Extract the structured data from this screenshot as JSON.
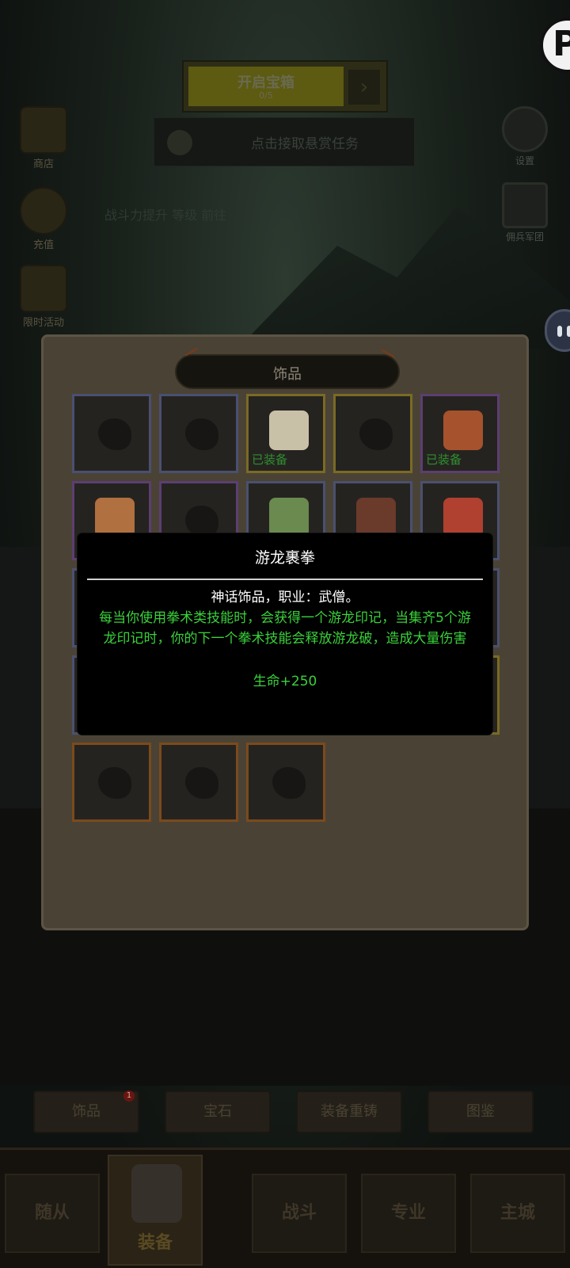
{
  "background": {
    "top_banner_title": "开启宝箱",
    "top_banner_sub": "0/5",
    "task_button": "点击接取悬赏任务",
    "dim_text": "战斗力提升 等级 前往",
    "left_buttons": [
      {
        "label": "商店",
        "icon": "chest-icon"
      },
      {
        "label": "充值",
        "icon": "coin-icon"
      },
      {
        "label": "限时活动",
        "icon": "armor-icon"
      }
    ],
    "right_buttons": [
      {
        "label": "设置",
        "icon": "gear-icon"
      },
      {
        "label": "佣兵军团",
        "icon": "castle-icon"
      }
    ],
    "action_buttons": [
      {
        "label": "饰品",
        "badge": "1"
      },
      {
        "label": "宝石"
      },
      {
        "label": "装备重铸"
      },
      {
        "label": "图鉴"
      }
    ],
    "nav": [
      {
        "label": "随从"
      },
      {
        "label": "装备"
      },
      {
        "label": "战斗"
      },
      {
        "label": "专业"
      },
      {
        "label": "主城"
      }
    ]
  },
  "panel": {
    "title": "饰品",
    "equipped_label": "已装备",
    "slots": [
      {
        "rarity": "blue",
        "equipped": false,
        "item": false
      },
      {
        "rarity": "blue",
        "equipped": false,
        "item": false
      },
      {
        "rarity": "yellow",
        "equipped": true,
        "item": true,
        "item_color": "#c9c0a8"
      },
      {
        "rarity": "yellow",
        "equipped": false,
        "item": false
      },
      {
        "rarity": "purple",
        "equipped": true,
        "item": true,
        "item_color": "#a6522c"
      },
      {
        "rarity": "purple",
        "equipped": false,
        "item": true,
        "item_color": "#b07040"
      },
      {
        "rarity": "purple",
        "equipped": false,
        "item": false
      },
      {
        "rarity": "blue",
        "equipped": false,
        "item": true,
        "item_color": "#6a8a50"
      },
      {
        "rarity": "blue",
        "equipped": false,
        "item": true,
        "item_color": "#6a3a2a"
      },
      {
        "rarity": "blue",
        "equipped": false,
        "item": true,
        "item_color": "#b04030"
      },
      {
        "rarity": "blue",
        "equipped": false,
        "item": false
      },
      {
        "rarity": "blue",
        "equipped": false,
        "item": false
      },
      {
        "rarity": "blue",
        "equipped": false,
        "item": false
      },
      {
        "rarity": "blue",
        "equipped": false,
        "item": false
      },
      {
        "rarity": "blue",
        "equipped": false,
        "item": false
      },
      {
        "rarity": "blue",
        "equipped": false,
        "item": false
      },
      {
        "rarity": "yellow",
        "equipped": false,
        "item": false
      },
      {
        "rarity": "yellow",
        "equipped": false,
        "item": false
      },
      {
        "rarity": "yellow",
        "equipped": false,
        "item": false
      },
      {
        "rarity": "yellow",
        "equipped": false,
        "item": false
      },
      {
        "rarity": "orange",
        "equipped": false,
        "item": false
      },
      {
        "rarity": "orange",
        "equipped": false,
        "item": false
      },
      {
        "rarity": "orange",
        "equipped": false,
        "item": false
      }
    ]
  },
  "tooltip": {
    "name": "游龙裹拳",
    "type_line": "神话饰品，职业：武僧。",
    "description": "每当你使用拳术类技能时，会获得一个游龙印记，当集齐5个游龙印记时，你的下一个拳术技能会释放游龙破，造成大量伤害",
    "stat": "生命+250",
    "text_color": "#3ad13a"
  }
}
